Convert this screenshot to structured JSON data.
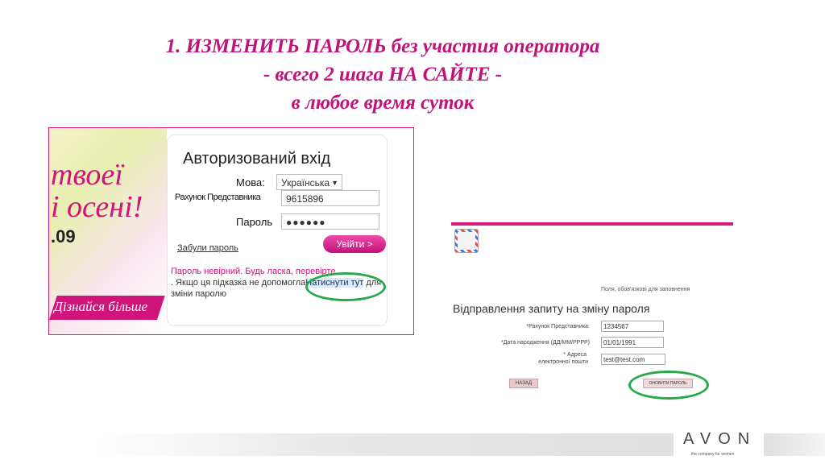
{
  "title": {
    "line1": "1. ИЗМЕНИТЬ ПАРОЛЬ без участия оператора",
    "line2": "- всего 2 шага НА САЙТЕ -",
    "line3": "в любое время суток"
  },
  "login_screen": {
    "banner": {
      "text1": "твоеї",
      "text2": "і осені!",
      "text3": ".09",
      "more_link": "Дізнайся більше"
    },
    "heading": "Авторизований вхід",
    "language_label": "Мова:",
    "language_value": "Українська",
    "account_label": "Рахунок Представника",
    "account_value": "9615896",
    "password_label": "Пароль",
    "password_value": "●●●●●●",
    "forgot_link": "Забули пароль",
    "login_button": "Увійти >",
    "error_line1": "Пароль невірний. Будь ласка, перевірте",
    "error_line2_prefix": ". Якщо ця підказка не допомогла",
    "click_here": "Натиснути тут",
    "error_line2_suffix": "для",
    "error_line3": "зміни паролю"
  },
  "reset_screen": {
    "required_note": "Поля, обов'язкові для заповнення",
    "heading": "Відправлення запиту на зміну пароля",
    "account_label": "*Рахунок Представника:",
    "account_value": "1234567",
    "dob_label": "*Дата народження (ДД/ММ/РРРР)",
    "dob_value": "01/01/1991",
    "email_label_line1": "* Адреса",
    "email_label_line2": "електронної пошти",
    "email_value": "test@test.com",
    "back_button": "НАЗАД",
    "update_button": "ОНОВИТИ ПАРОЛЬ"
  },
  "footer": {
    "logo": "AVON",
    "tagline": "the company for women"
  },
  "colors": {
    "accent": "#c0137a",
    "highlight_oval": "#27a84a"
  }
}
